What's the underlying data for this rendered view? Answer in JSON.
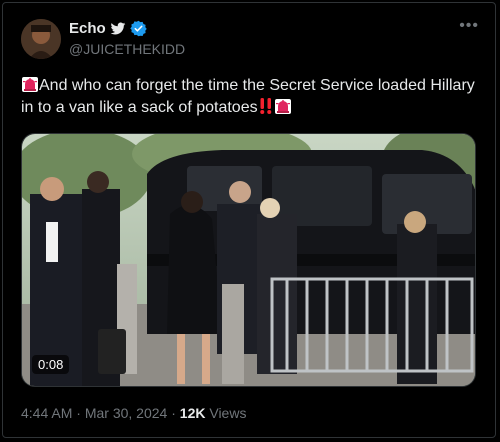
{
  "author": {
    "name": "Echo",
    "handle": "@JUICETHEKIDD"
  },
  "icons": {
    "bird": "bird-icon",
    "verified": "verified-badge-icon",
    "more": "more-options-icon",
    "siren": "siren-emoji",
    "exclamation": "double-exclamation-emoji"
  },
  "tweet": {
    "text": "And who can forget the time the Secret Service loaded Hillary in to a van like a sack of potatoes"
  },
  "media": {
    "duration": "0:08"
  },
  "meta": {
    "time": "4:44 AM",
    "separator": "·",
    "date": "Mar 30, 2024",
    "views_count": "12K",
    "views_label": "Views"
  },
  "colors": {
    "background": "#000000",
    "text": "#e7e9ea",
    "muted": "#71767b",
    "verified": "#1d9bf0",
    "border": "#2f3336"
  }
}
